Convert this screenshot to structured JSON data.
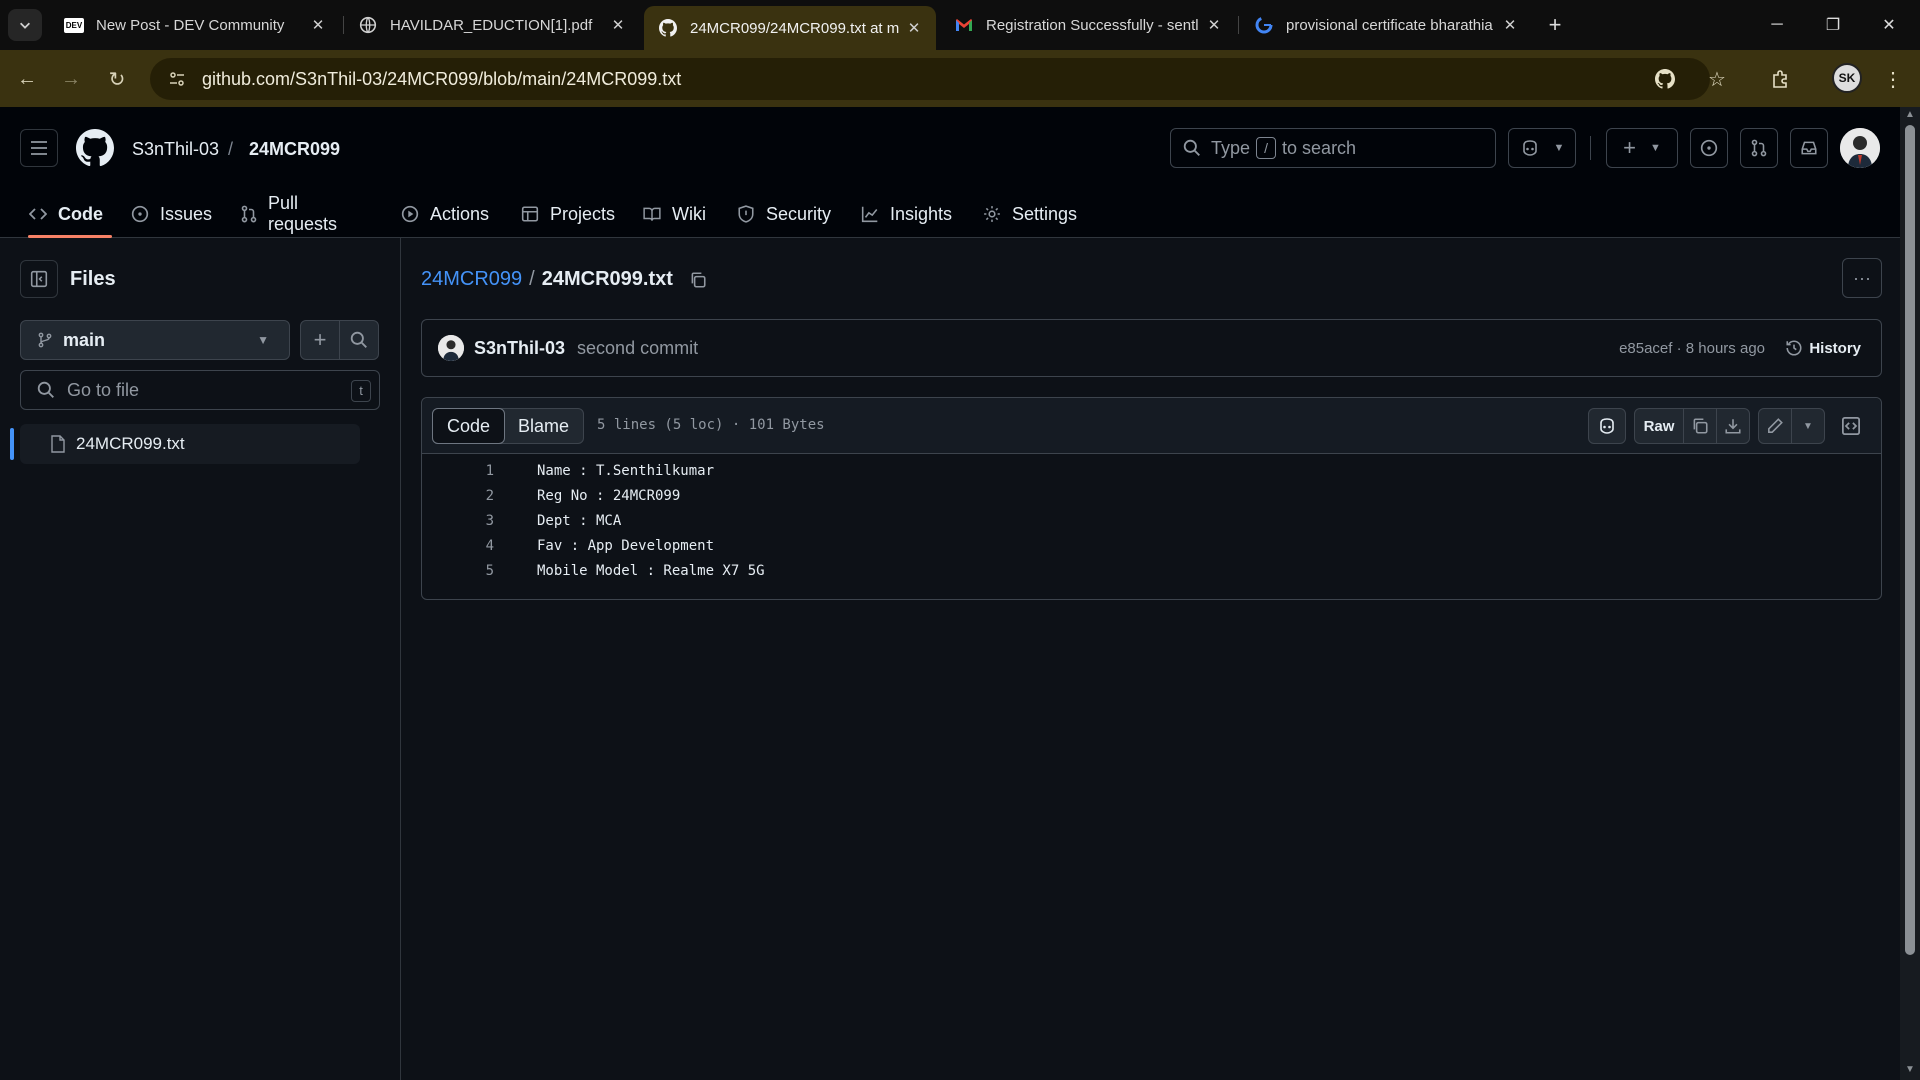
{
  "browser": {
    "tabs": [
      {
        "title": "New Post - DEV Community",
        "favicon": "dev-logo-icon",
        "active": false
      },
      {
        "title": "HAVILDAR_EDUCTION[1].pdf",
        "favicon": "globe-icon",
        "active": false
      },
      {
        "title": "24MCR099/24MCR099.txt at m",
        "favicon": "github-icon",
        "active": true
      },
      {
        "title": "Registration Successfully - sentl",
        "favicon": "gmail-icon",
        "active": false
      },
      {
        "title": "provisional certificate bharathia",
        "favicon": "google-icon",
        "active": false
      }
    ],
    "dev_logo_text": "DEV",
    "url": "github.com/S3nThil-03/24MCR099/blob/main/24MCR099.txt",
    "profile_initials": "SK",
    "theme_color": "#3a3210"
  },
  "github": {
    "owner": "S3nThil-03",
    "crumb_separator": "/",
    "repo": "24MCR099",
    "search": {
      "prefix": "Type",
      "key": "/",
      "suffix": "to search"
    },
    "nav": [
      {
        "label": "Code",
        "icon": "code-icon",
        "active": true
      },
      {
        "label": "Issues",
        "icon": "issue-opened-icon"
      },
      {
        "label": "Pull requests",
        "icon": "git-pull-request-icon"
      },
      {
        "label": "Actions",
        "icon": "play-icon"
      },
      {
        "label": "Projects",
        "icon": "table-icon"
      },
      {
        "label": "Wiki",
        "icon": "book-icon"
      },
      {
        "label": "Security",
        "icon": "shield-icon"
      },
      {
        "label": "Insights",
        "icon": "graph-icon"
      },
      {
        "label": "Settings",
        "icon": "gear-icon"
      }
    ],
    "accent": "#f78166",
    "link_color": "#4493f8"
  },
  "sidebar": {
    "title": "Files",
    "branch": "main",
    "goto_placeholder": "Go to file",
    "goto_key": "t",
    "tree": [
      {
        "name": "24MCR099.txt",
        "icon": "file-icon",
        "selected": true
      }
    ]
  },
  "file": {
    "path_repo": "24MCR099",
    "path_sep": "/",
    "path_file": "24MCR099.txt",
    "commit": {
      "author": "S3nThil-03",
      "message": "second commit",
      "meta": "e85acef · 8 hours ago",
      "history_label": "History"
    },
    "view_tabs": {
      "code": "Code",
      "blame": "Blame"
    },
    "info": "5 lines (5 loc) · 101 Bytes",
    "raw_label": "Raw",
    "lines": [
      {
        "n": "1",
        "text": "Name : T.Senthilkumar"
      },
      {
        "n": "2",
        "text": "Reg No : 24MCR099"
      },
      {
        "n": "3",
        "text": "Dept : MCA"
      },
      {
        "n": "4",
        "text": "Fav : App Development"
      },
      {
        "n": "5",
        "text": "Mobile Model : Realme X7 5G"
      }
    ]
  }
}
